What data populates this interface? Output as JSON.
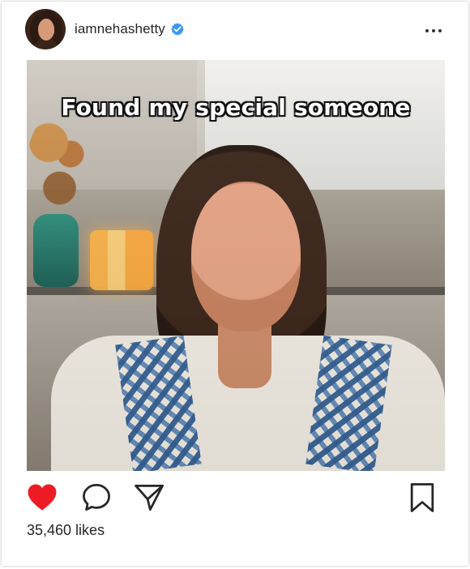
{
  "header": {
    "username": "iamnehashetty"
  },
  "post": {
    "overlay_text": "Found my special someone"
  },
  "stats": {
    "likes": "35,460 likes"
  },
  "colors": {
    "verified_badge": "#3897f0",
    "like_heart": "#ed1c24",
    "text_primary": "#262626"
  },
  "icons": {
    "verified": "verified-badge-icon",
    "more": "more-options-icon",
    "like": "heart-icon",
    "comment": "comment-icon",
    "share": "share-icon",
    "save": "bookmark-icon"
  }
}
